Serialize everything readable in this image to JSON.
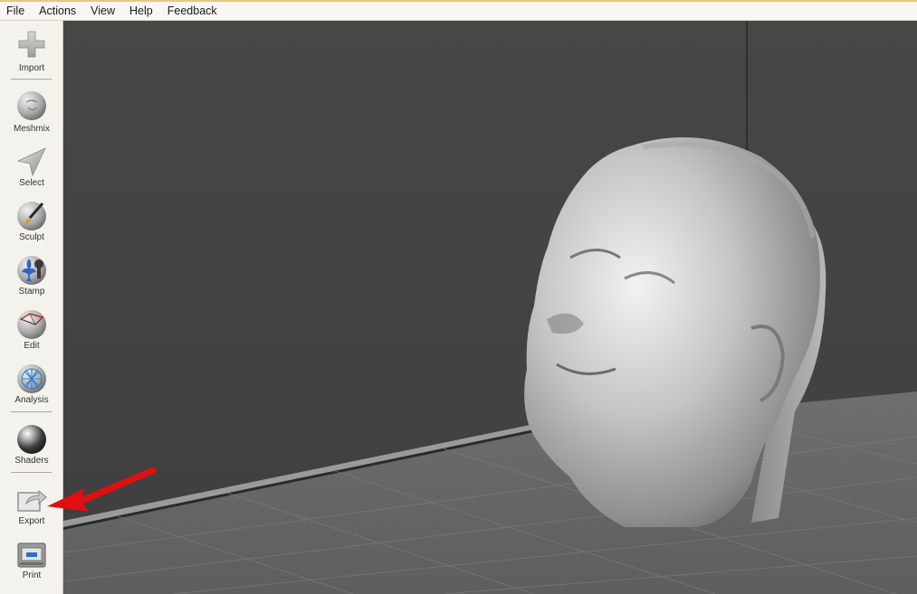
{
  "menubar": {
    "items": [
      "File",
      "Actions",
      "View",
      "Help",
      "Feedback"
    ]
  },
  "toolbar": {
    "tools": [
      {
        "label": "Import",
        "icon": "plus-icon"
      },
      {
        "label": "Meshmix",
        "icon": "meshmix-sphere-icon"
      },
      {
        "label": "Select",
        "icon": "select-arrow-icon"
      },
      {
        "label": "Sculpt",
        "icon": "sculpt-brush-icon"
      },
      {
        "label": "Stamp",
        "icon": "stamp-icon"
      },
      {
        "label": "Edit",
        "icon": "edit-sphere-icon"
      },
      {
        "label": "Analysis",
        "icon": "analysis-sphere-icon"
      },
      {
        "label": "Shaders",
        "icon": "shader-sphere-icon"
      },
      {
        "label": "Export",
        "icon": "export-icon"
      },
      {
        "label": "Print",
        "icon": "printer-icon"
      }
    ]
  },
  "colors": {
    "viewport_wall": "#444444",
    "viewport_floor": "#6a6a6a",
    "annotation_arrow": "#e01010",
    "menubar_accent": "#e8c87a"
  }
}
